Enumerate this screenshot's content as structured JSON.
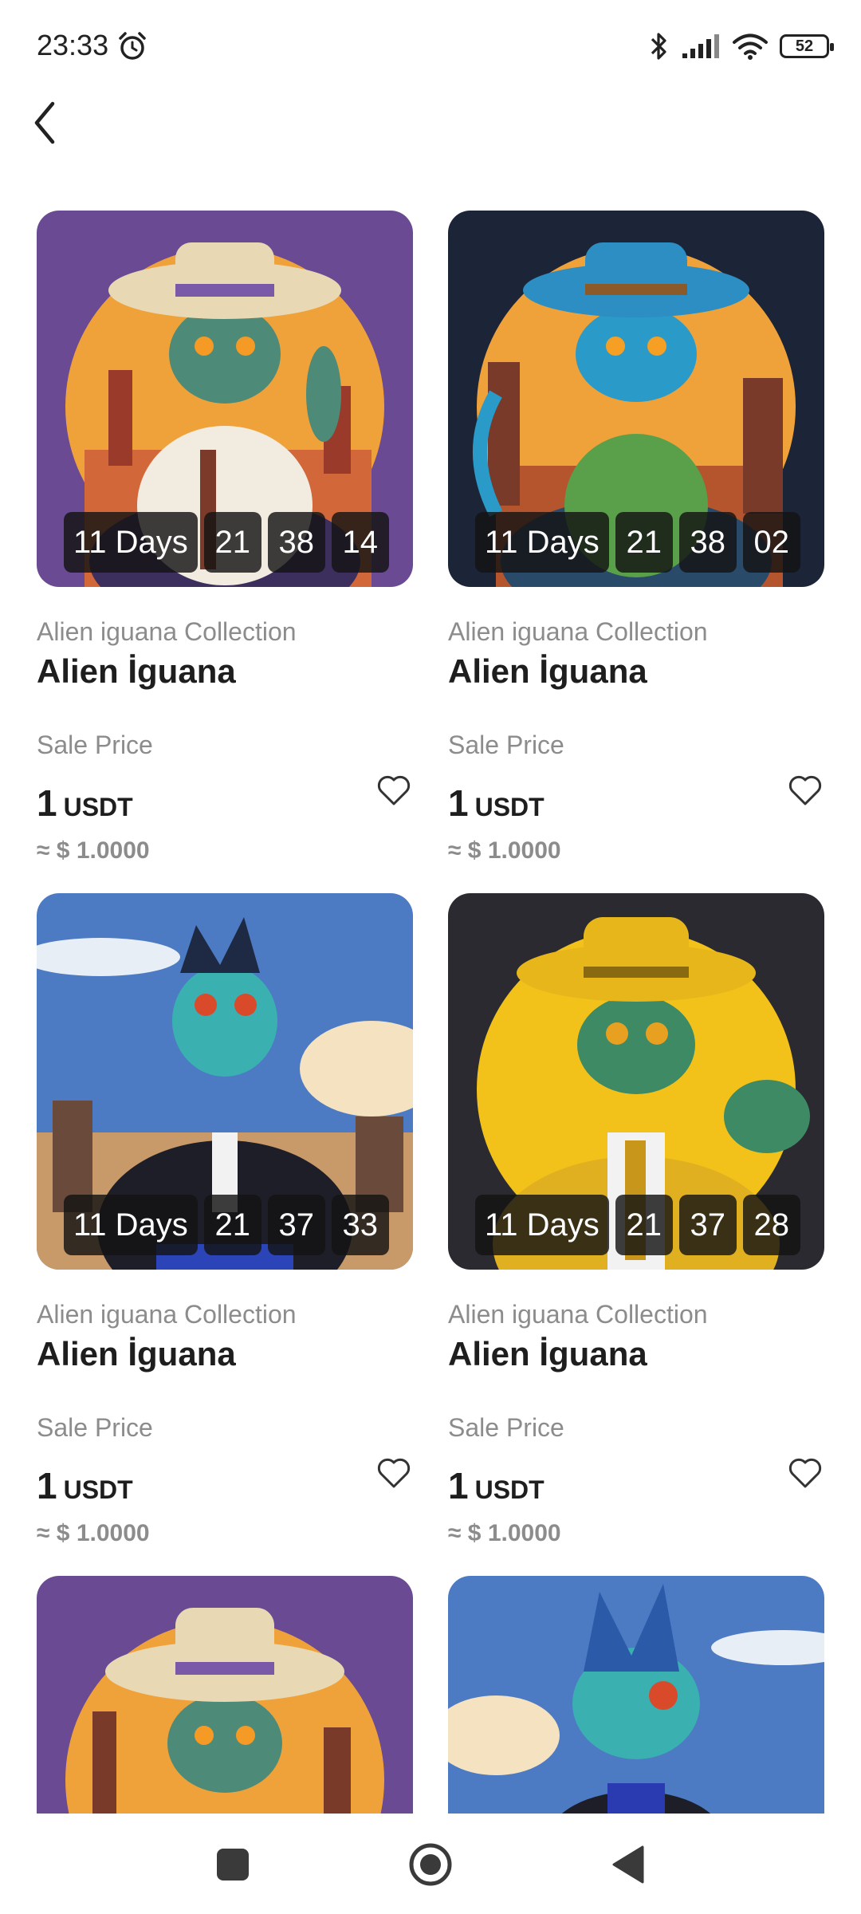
{
  "status_bar": {
    "time": "23:33",
    "battery": "52",
    "icons": [
      "alarm-icon",
      "bluetooth-icon",
      "signal-icon",
      "wifi-icon",
      "battery-icon"
    ]
  },
  "header": {
    "back_icon": "chevron-left-icon"
  },
  "cards": [
    {
      "days": "11 Days",
      "hours": "21",
      "minutes": "38",
      "seconds": "14",
      "collection": "Alien iguana Collection",
      "name": "Alien İguana",
      "sale_label": "Sale Price",
      "price": "1",
      "currency": "USDT",
      "approx": "≈ $ 1.0000"
    },
    {
      "days": "11 Days",
      "hours": "21",
      "minutes": "38",
      "seconds": "02",
      "collection": "Alien iguana Collection",
      "name": "Alien İguana",
      "sale_label": "Sale Price",
      "price": "1",
      "currency": "USDT",
      "approx": "≈ $ 1.0000"
    },
    {
      "days": "11 Days",
      "hours": "21",
      "minutes": "37",
      "seconds": "33",
      "collection": "Alien iguana Collection",
      "name": "Alien İguana",
      "sale_label": "Sale Price",
      "price": "1",
      "currency": "USDT",
      "approx": "≈ $ 1.0000"
    },
    {
      "days": "11 Days",
      "hours": "21",
      "minutes": "37",
      "seconds": "28",
      "collection": "Alien iguana Collection",
      "name": "Alien İguana",
      "sale_label": "Sale Price",
      "price": "1",
      "currency": "USDT",
      "approx": "≈ $ 1.0000"
    }
  ],
  "nav_bar": {
    "icons": [
      "recents-icon",
      "home-icon",
      "back-icon"
    ]
  },
  "colors": {
    "purple_bg": "#6a4a92",
    "navy_bg": "#1c2438",
    "sky_bg": "#4c7bc4",
    "dark_bg": "#2a2a30",
    "yellow_moon": "#f2c21a",
    "orange_moon": "#f0a23a"
  }
}
